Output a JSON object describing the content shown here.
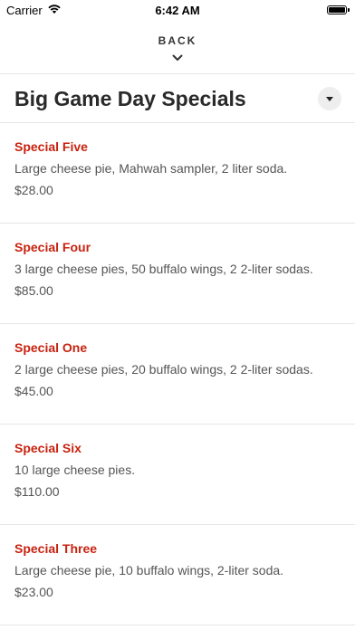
{
  "status_bar": {
    "carrier": "Carrier",
    "time": "6:42 AM"
  },
  "nav": {
    "back_label": "BACK"
  },
  "header": {
    "title": "Big Game Day Specials"
  },
  "colors": {
    "accent": "#c8220f",
    "divider": "#e6e6e6",
    "dropdown_bg": "#eeeeee"
  },
  "specials": [
    {
      "name": "Special Five",
      "description": "Large cheese pie, Mahwah sampler, 2 liter soda.",
      "price": "$28.00"
    },
    {
      "name": "Special Four",
      "description": "3 large cheese pies, 50 buffalo wings, 2 2-liter sodas.",
      "price": "$85.00"
    },
    {
      "name": "Special One",
      "description": "2 large cheese pies, 20 buffalo wings, 2 2-liter sodas.",
      "price": "$45.00"
    },
    {
      "name": "Special Six",
      "description": "10 large cheese pies.",
      "price": "$110.00"
    },
    {
      "name": "Special Three",
      "description": "Large cheese pie, 10 buffalo wings, 2-liter soda.",
      "price": "$23.00"
    }
  ]
}
